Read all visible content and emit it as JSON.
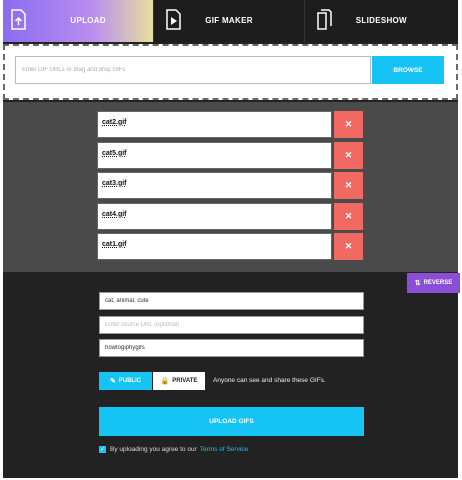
{
  "tabs": {
    "upload": "UPLOAD",
    "gif_maker": "GIF MAKER",
    "slideshow": "SLIDESHOW"
  },
  "drop": {
    "url_placeholder": "Enter GIF URLs or drag and drop GIFs",
    "browse_label": "BROWSE"
  },
  "files": [
    {
      "name": "cat2.gif",
      "remove": "✕"
    },
    {
      "name": "cat5.gif",
      "remove": "✕"
    },
    {
      "name": "cat3.gif",
      "remove": "✕"
    },
    {
      "name": "cat4.gif",
      "remove": "✕"
    },
    {
      "name": "cat1.gif",
      "remove": "✕"
    }
  ],
  "reverse": {
    "icon": "⇅",
    "label": "REVERSE"
  },
  "details": {
    "tags_value": "cat, animal, cute",
    "source_placeholder": "Enter source URL (optional)",
    "username_value": "howtogiphygifs"
  },
  "privacy": {
    "public_icon": "✎",
    "public_label": "PUBLIC",
    "private_icon": "🔒",
    "private_label": "PRIVATE",
    "description": "Anyone can see and share these GIFs."
  },
  "upload_button": "UPLOAD GIFS",
  "agree": {
    "check": "✓",
    "text": "By uploading you agree to our",
    "link": "Terms of Service"
  },
  "colors": {
    "accent": "#16c3f5",
    "remove": "#f06a63",
    "reverse": "#8a4fd6"
  }
}
